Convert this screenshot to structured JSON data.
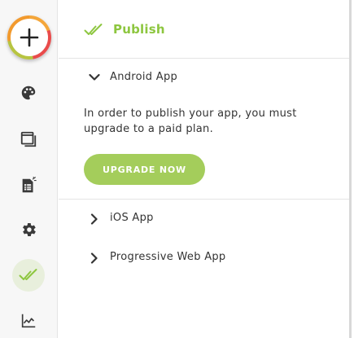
{
  "sidebar": {
    "add_icon": "plus-icon",
    "items": [
      {
        "name": "palette-icon"
      },
      {
        "name": "pages-icon"
      },
      {
        "name": "data-sheet-icon"
      },
      {
        "name": "gear-icon"
      },
      {
        "name": "publish-check-icon",
        "active": true
      },
      {
        "name": "analytics-icon"
      }
    ]
  },
  "header": {
    "title": "Publish",
    "icon": "double-check-icon",
    "accent_color": "#8dc63f"
  },
  "sections": [
    {
      "label": "Android App",
      "expanded": true,
      "message": "In order to publish your app, you must upgrade to a paid plan.",
      "button_label": "UPGRADE NOW",
      "button_color": "#a4cd5b"
    },
    {
      "label": "iOS App",
      "expanded": false
    },
    {
      "label": "Progressive Web App",
      "expanded": false
    }
  ]
}
